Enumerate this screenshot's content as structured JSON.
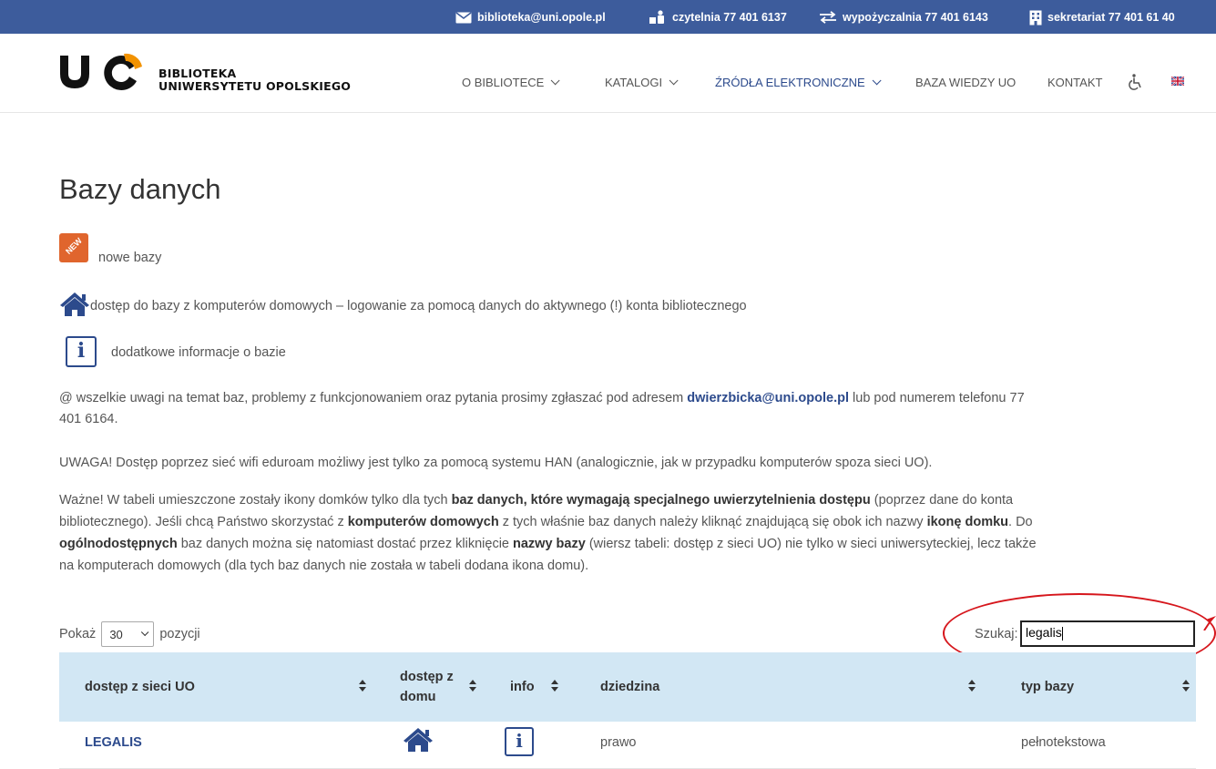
{
  "topbar": {
    "email": "biblioteka@uni.opole.pl",
    "reading_room": "czytelnia 77 401 6137",
    "lending": "wypożyczalnia 77 401 6143",
    "secretariat": "sekretariat 77 401 61 40"
  },
  "logo": {
    "mark": "UO",
    "line1": "BIBLIOTEKA",
    "line2": "UNIWERSYTETU OPOLSKIEGO"
  },
  "nav": {
    "items": [
      {
        "label": "O BIBLIOTECE"
      },
      {
        "label": "KATALOGI"
      },
      {
        "label": "ŹRÓDŁA ELEKTRONICZNE"
      },
      {
        "label": "BAZA WIEDZY UO"
      },
      {
        "label": "KONTAKT"
      }
    ]
  },
  "page": {
    "title": "Bazy danych",
    "new_badge": "NEW",
    "legend_new": "nowe bazy",
    "legend_home": "dostęp do bazy z komputerów domowych – logowanie za pomocą danych do aktywnego (!) konta bibliotecznego",
    "legend_info": "dodatkowe informacje o bazie",
    "contact_pre": "@ wszelkie uwagi na temat baz, problemy z funkcjonowaniem oraz pytania prosimy zgłaszać pod adresem ",
    "contact_email": "dwierzbicka@uni.opole.pl",
    "contact_post": " lub pod numerem telefonu 77",
    "contact_line2": "401 6164.",
    "warning": "UWAGA! Dostęp poprzez sieć wifi eduroam możliwy jest tylko za pomocą systemu HAN (analogicznie, jak w przypadku komputerów spoza sieci UO).",
    "important": {
      "t1": "Ważne! W tabeli umieszczone zostały ikony domków tylko dla tych ",
      "b1": "baz danych, które wymagają specjalnego uwierzytelnienia dostępu",
      "t2": " (poprzez dane do konta",
      "t3": "bibliotecznego). Jeśli chcą Państwo skorzystać z ",
      "b2": "komputerów domowych",
      "t4": " z tych właśnie baz danych należy kliknąć znajdującą się obok ich nazwy ",
      "b3": "ikonę domku",
      "t5": ". Do",
      "b4": "ogólnodostępnych",
      "t6": " baz danych można się natomiast dostać przez kliknięcie ",
      "b5": "nazwy bazy",
      "t7": " (wiersz tabeli: dostęp z sieci UO) nie tylko w sieci uniwersyteckiej, lecz także",
      "t8": "na komputerach domowych (dla tych baz danych nie została w tabeli dodana ikona domu)."
    }
  },
  "table_controls": {
    "show_label": "Pokaż",
    "page_size": "30",
    "entries_label": "pozycji",
    "search_label": "Szukaj:",
    "search_value": "legalis"
  },
  "table": {
    "headers": [
      "dostęp z sieci UO",
      "dostęp z domu",
      "info",
      "dziedzina",
      "typ bazy"
    ],
    "rows": [
      {
        "name": "LEGALIS",
        "domain": "prawo",
        "type": "pełnotekstowa"
      }
    ]
  },
  "colors": {
    "topbar": "#3d5c9c",
    "accent": "#2c4a8c",
    "header_row": "#d2e7f4",
    "highlight": "#d6161c",
    "new_badge": "#e0652d"
  }
}
